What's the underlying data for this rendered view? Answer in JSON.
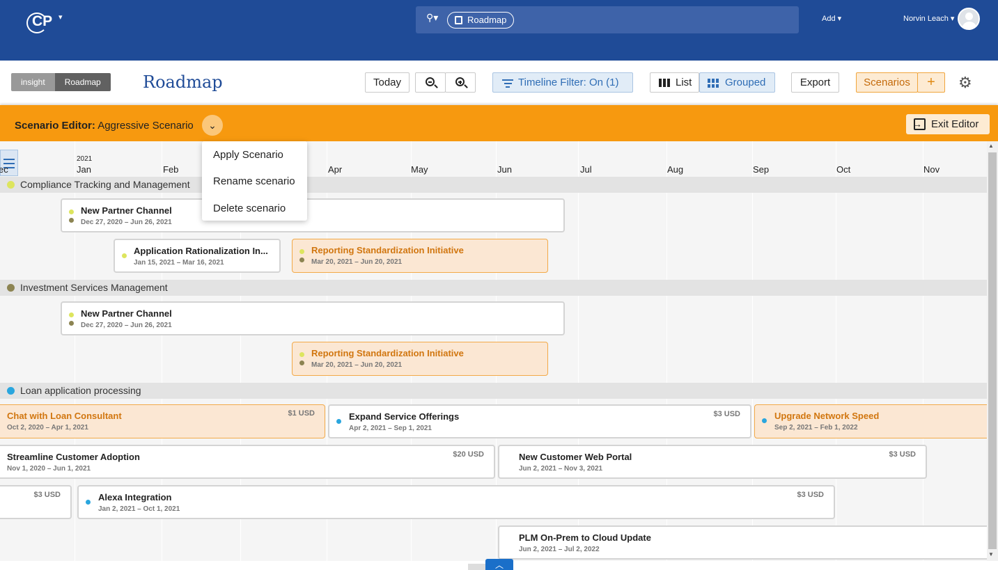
{
  "topbar": {
    "logo": "CP",
    "breadcrumb": "Roadmap",
    "add_label": "Add",
    "user_name": "Norvin Leach",
    "bg_color": "#1f4b97"
  },
  "toolbar": {
    "seg_insight": "insight",
    "seg_roadmap": "Roadmap",
    "page_title": "Roadmap",
    "today": "Today",
    "timeline_filter": "Timeline Filter: On (1)",
    "list": "List",
    "grouped": "Grouped",
    "export": "Export",
    "scenarios": "Scenarios",
    "scenarios_add": "+"
  },
  "editor": {
    "label": "Scenario Editor:",
    "scenario_name": "Aggressive Scenario",
    "exit": "Exit Editor",
    "accent_color": "#f7990f"
  },
  "dropdown": {
    "items": [
      "Apply Scenario",
      "Rename scenario",
      "Delete scenario"
    ]
  },
  "timeline": {
    "year": "2021",
    "months": [
      "ec",
      "Jan",
      "Feb",
      "Apr",
      "May",
      "Jun",
      "Jul",
      "Aug",
      "Sep",
      "Oct",
      "Nov"
    ],
    "groups": [
      {
        "name": "Compliance Tracking and Management",
        "dot_color": "#dde55e",
        "cards": [
          {
            "title": "New Partner Channel",
            "dates": "Dec 27, 2020 – Jun 26, 2021",
            "selected": false
          },
          {
            "title": "Application Rationalization In...",
            "dates": "Jan 15, 2021 – Mar 16, 2021",
            "selected": false
          },
          {
            "title": "Reporting Standardization Initiative",
            "dates": "Mar 20, 2021 – Jun 20, 2021",
            "selected": true
          }
        ]
      },
      {
        "name": "Investment Services Management",
        "dot_color": "#8c8452",
        "cards": [
          {
            "title": "New Partner Channel",
            "dates": "Dec 27, 2020 – Jun 26, 2021",
            "selected": false
          },
          {
            "title": "Reporting Standardization Initiative",
            "dates": "Mar 20, 2021 – Jun 20, 2021",
            "selected": true
          }
        ]
      },
      {
        "name": "Loan application processing",
        "dot_color": "#2aa6de",
        "cards": [
          {
            "title": "Chat with Loan Consultant",
            "dates": "Oct 2, 2020 – Apr 1, 2021",
            "cost": "$1 USD",
            "selected": true
          },
          {
            "title": "Expand Service Offerings",
            "dates": "Apr 2, 2021 – Sep 1, 2021",
            "cost": "$3 USD",
            "selected": false
          },
          {
            "title": "Upgrade Network Speed",
            "dates": "Sep 2, 2021 – Feb 1, 2022",
            "selected": true
          },
          {
            "title": "Streamline Customer Adoption",
            "dates": "Nov 1, 2020 – Jun 1, 2021",
            "cost": "$20 USD",
            "selected": false
          },
          {
            "title": "New Customer Web Portal",
            "dates": "Jun 2, 2021 – Nov 3, 2021",
            "cost": "$3 USD",
            "selected": false
          },
          {
            "cost": "$3 USD"
          },
          {
            "title": "Alexa Integration",
            "dates": "Jan 2, 2021 – Oct 1, 2021",
            "cost": "$3 USD",
            "selected": false
          },
          {
            "title": "PLM On-Prem to Cloud Update",
            "dates": "Jun 2, 2021 – Jul 2, 2022",
            "selected": false
          }
        ]
      }
    ]
  }
}
